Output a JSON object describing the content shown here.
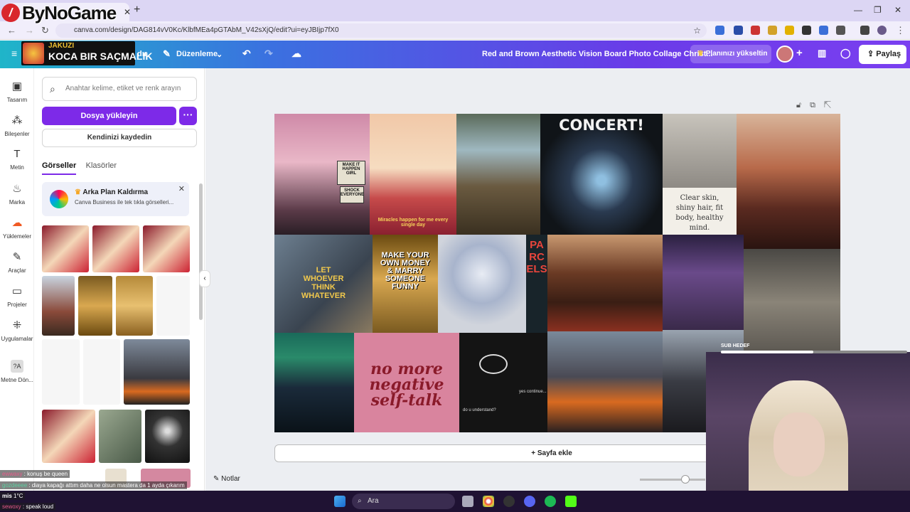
{
  "browser": {
    "url": "canva.com/design/DAG814vV0Kc/KlbfMEa4pGTAbM_V42sXjQ/edit?ui=eyJBIjp7fX0"
  },
  "overlay": {
    "logo_text": "ByNoGame",
    "promo_line1": "JAKUZI",
    "promo_line2": "KOCA BIR SAÇMALIK",
    "sub_goal_label": "SUB HEDEF"
  },
  "header": {
    "partial_text": "dır",
    "edit_label": "Düzenleme",
    "design_title": "Red and Brown Aesthetic Vision Board Photo Collage Christ...",
    "upgrade_label": "Planınızı yükseltin",
    "share_label": "Paylaş"
  },
  "rail": {
    "items": [
      {
        "label": "Tasarım",
        "icon": "layout-icon"
      },
      {
        "label": "Bileşenler",
        "icon": "shapes-icon"
      },
      {
        "label": "Metin",
        "icon": "text-icon"
      },
      {
        "label": "Marka",
        "icon": "brand-icon"
      },
      {
        "label": "Yüklemeler",
        "icon": "cloud-upload-icon"
      },
      {
        "label": "Araçlar",
        "icon": "pen-icon"
      },
      {
        "label": "Projeler",
        "icon": "folder-icon"
      },
      {
        "label": "Uygulamalar",
        "icon": "apps-icon"
      },
      {
        "label": "Metne Dön...",
        "icon": "text-convert-icon"
      }
    ]
  },
  "panel": {
    "search_placeholder": "Anahtar kelime, etiket ve renk arayın",
    "upload_label": "Dosya yükleyin",
    "more_label": "···",
    "record_label": "Kendinizi kaydedin",
    "tabs": [
      "Görseller",
      "Klasörler"
    ],
    "promo_title": "Arka Plan Kaldırma",
    "promo_text": "Canva Business ile tek tıkla görselleri..."
  },
  "board": {
    "texts": {
      "sign1": "MAKE IT HAPPEN GIRL",
      "sign2": "SHOCK EVERYONE",
      "miracles": "Miracles happen for me every single day",
      "concert": "CONCERT!",
      "clear_skin": "Clear skin, shiny hair, fit body, healthy mind.",
      "let_whoever": "LET WHOEVER THINK WHATEVER",
      "make_money": "MAKE YOUR OWN MONEY & MARRY SOMEONE FUNNY",
      "parcels": "PARCELS",
      "negative": "no more negative self-talk",
      "yes_continue": "yes continue...",
      "do_u": "do u understand?"
    }
  },
  "canvas": {
    "add_page": "+ Sayfa ekle",
    "notes": "Notlar"
  },
  "chat": [
    {
      "user": "ewwaxy",
      "msg": "konuş be queen"
    },
    {
      "user": "gozdeeee",
      "msg": "diaya kapağı attım daha ne olsun mastera da 1 ayda çıkarım"
    },
    {
      "user": "mis",
      "msg": "1°C"
    },
    {
      "user": "sewoxy",
      "msg": "speak loud"
    }
  ],
  "taskbar": {
    "search_label": "Ara"
  },
  "colors": {
    "canva_purple": "#7d2ae8",
    "header_gradient_start": "#1fb5c9",
    "header_gradient_end": "#7a3ff0"
  }
}
